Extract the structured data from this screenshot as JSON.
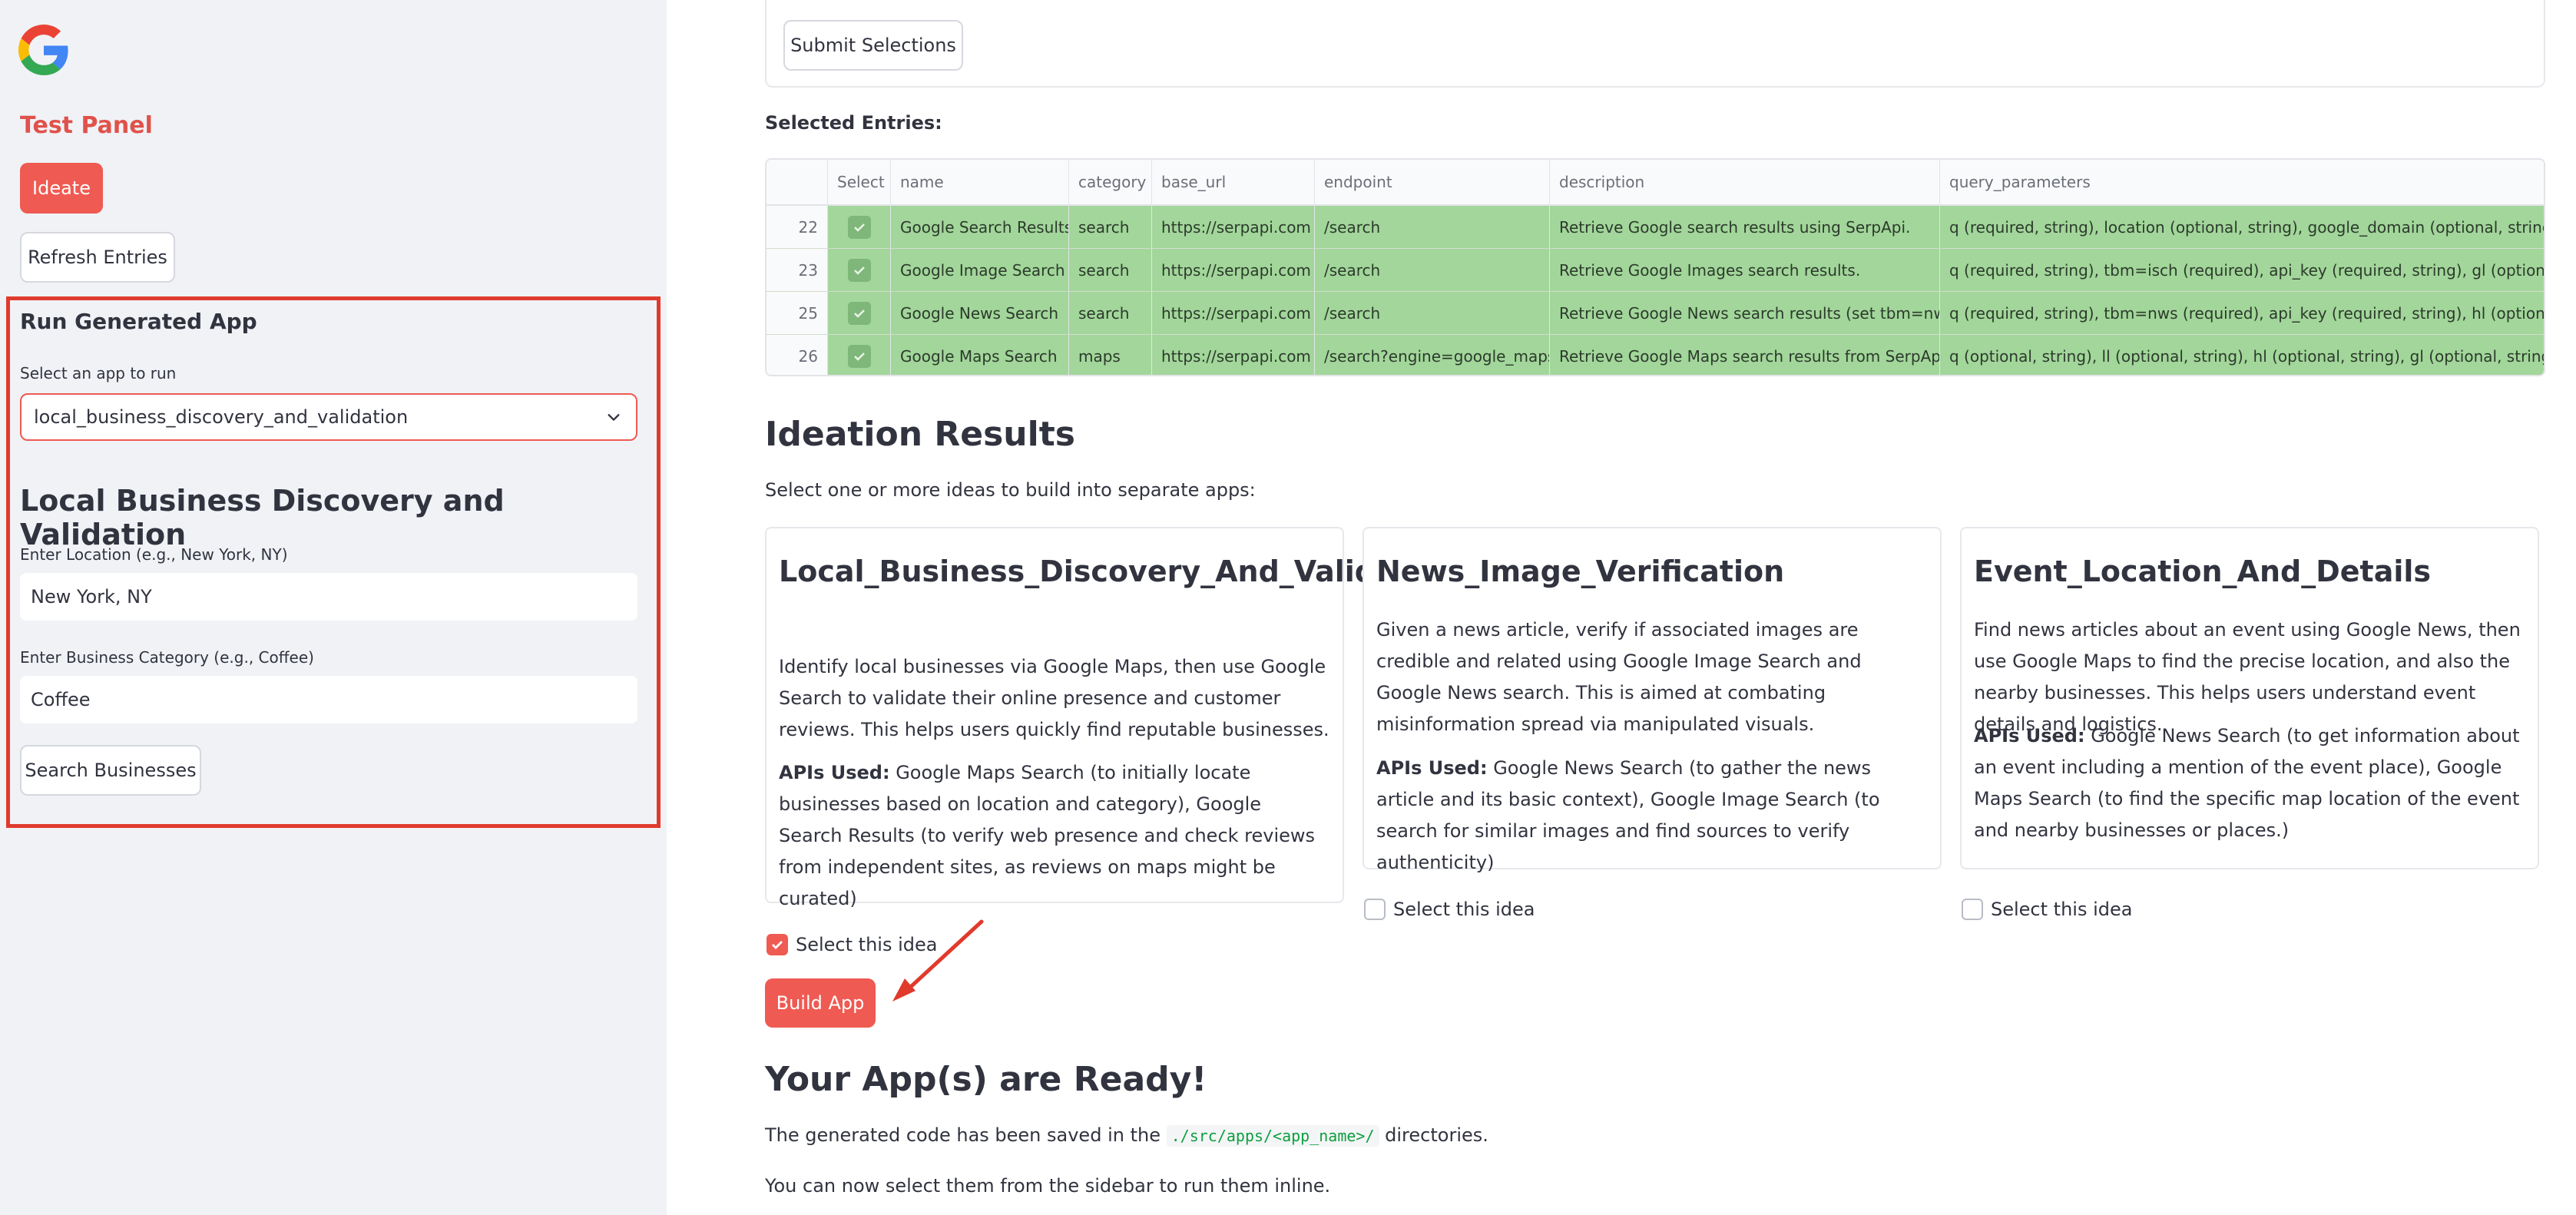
{
  "sidebar": {
    "panel_title": "Test Panel",
    "ideate_label": "Ideate",
    "refresh_label": "Refresh Entries",
    "run_title": "Run Generated App",
    "select_label": "Select an app to run",
    "select_value": "local_business_discovery_and_validation",
    "app_title": "Local Business Discovery and Validation",
    "location_label": "Enter Location (e.g., New York, NY)",
    "location_value": "New York, NY",
    "category_label": "Enter Business Category (e.g., Coffee)",
    "category_value": "Coffee",
    "search_label": "Search Businesses"
  },
  "main": {
    "submit_label": "Submit Selections",
    "selected_entries_title": "Selected Entries:",
    "table": {
      "columns": [
        "Select",
        "name",
        "category",
        "base_url",
        "endpoint",
        "description",
        "query_parameters"
      ],
      "rows": [
        {
          "idx": "22",
          "name": "Google Search Results",
          "category": "search",
          "base_url": "https://serpapi.com",
          "endpoint": "/search",
          "description": "Retrieve Google search results using SerpApi.",
          "query_parameters": "q (required, string), location (optional, string), google_domain (optional, string), gl"
        },
        {
          "idx": "23",
          "name": "Google Image Search",
          "category": "search",
          "base_url": "https://serpapi.com",
          "endpoint": "/search",
          "description": "Retrieve Google Images search results.",
          "query_parameters": "q (required, string), tbm=isch (required), api_key (required, string), gl (optional, stri"
        },
        {
          "idx": "25",
          "name": "Google News Search",
          "category": "search",
          "base_url": "https://serpapi.com",
          "endpoint": "/search",
          "description": "Retrieve Google News search results (set tbm=nws).",
          "query_parameters": "q (required, string), tbm=nws (required), api_key (required, string), hl (optional, stri"
        },
        {
          "idx": "26",
          "name": "Google Maps Search",
          "category": "maps",
          "base_url": "https://serpapi.com",
          "endpoint": "/search?engine=google_maps",
          "description": "Retrieve Google Maps search results from SerpApi.",
          "query_parameters": "q (optional, string), ll (optional, string), hl (optional, string), gl (optional, string), sta"
        }
      ]
    },
    "ideation_title": "Ideation Results",
    "ideation_subtitle": "Select one or more ideas to build into separate apps:",
    "apis_used_label": "APIs Used:",
    "ideas": [
      {
        "title": "Local_Business_Discovery_And_Validation",
        "description": "Identify local businesses via Google Maps, then use Google Search to validate their online presence and customer reviews. This helps users quickly find reputable businesses.",
        "apis": "Google Maps Search (to initially locate businesses based on location and category), Google Search Results (to verify web presence and check reviews from independent sites, as reviews on maps might be curated)",
        "select_label": "Select this idea",
        "checked": true
      },
      {
        "title": "News_Image_Verification",
        "description": "Given a news article, verify if associated images are credible and related using Google Image Search and Google News search. This is aimed at combating misinformation spread via manipulated visuals.",
        "apis": "Google News Search (to gather the news article and its basic context), Google Image Search (to search for similar images and find sources to verify authenticity)",
        "select_label": "Select this idea",
        "checked": false
      },
      {
        "title": "Event_Location_And_Details",
        "description": "Find news articles about an event using Google News, then use Google Maps to find the precise location, and also the nearby businesses. This helps users understand event details and logistics.",
        "apis": "Google News Search (to get information about an event including a mention of the event place), Google Maps Search (to find the specific map location of the event and nearby businesses or places.)",
        "select_label": "Select this idea",
        "checked": false
      }
    ],
    "build_label": "Build App",
    "ready_title": "Your App(s) are Ready!",
    "saved_text_pre": "The generated code has been saved in the",
    "saved_path": "./src/apps/<app_name>/",
    "saved_text_post": "directories.",
    "sidebar_hint": "You can now select them from the sidebar to run them inline."
  },
  "colors": {
    "primary": "#ef5a52",
    "highlight_row": "#a2d69a",
    "annotation": "#e03a2c"
  }
}
